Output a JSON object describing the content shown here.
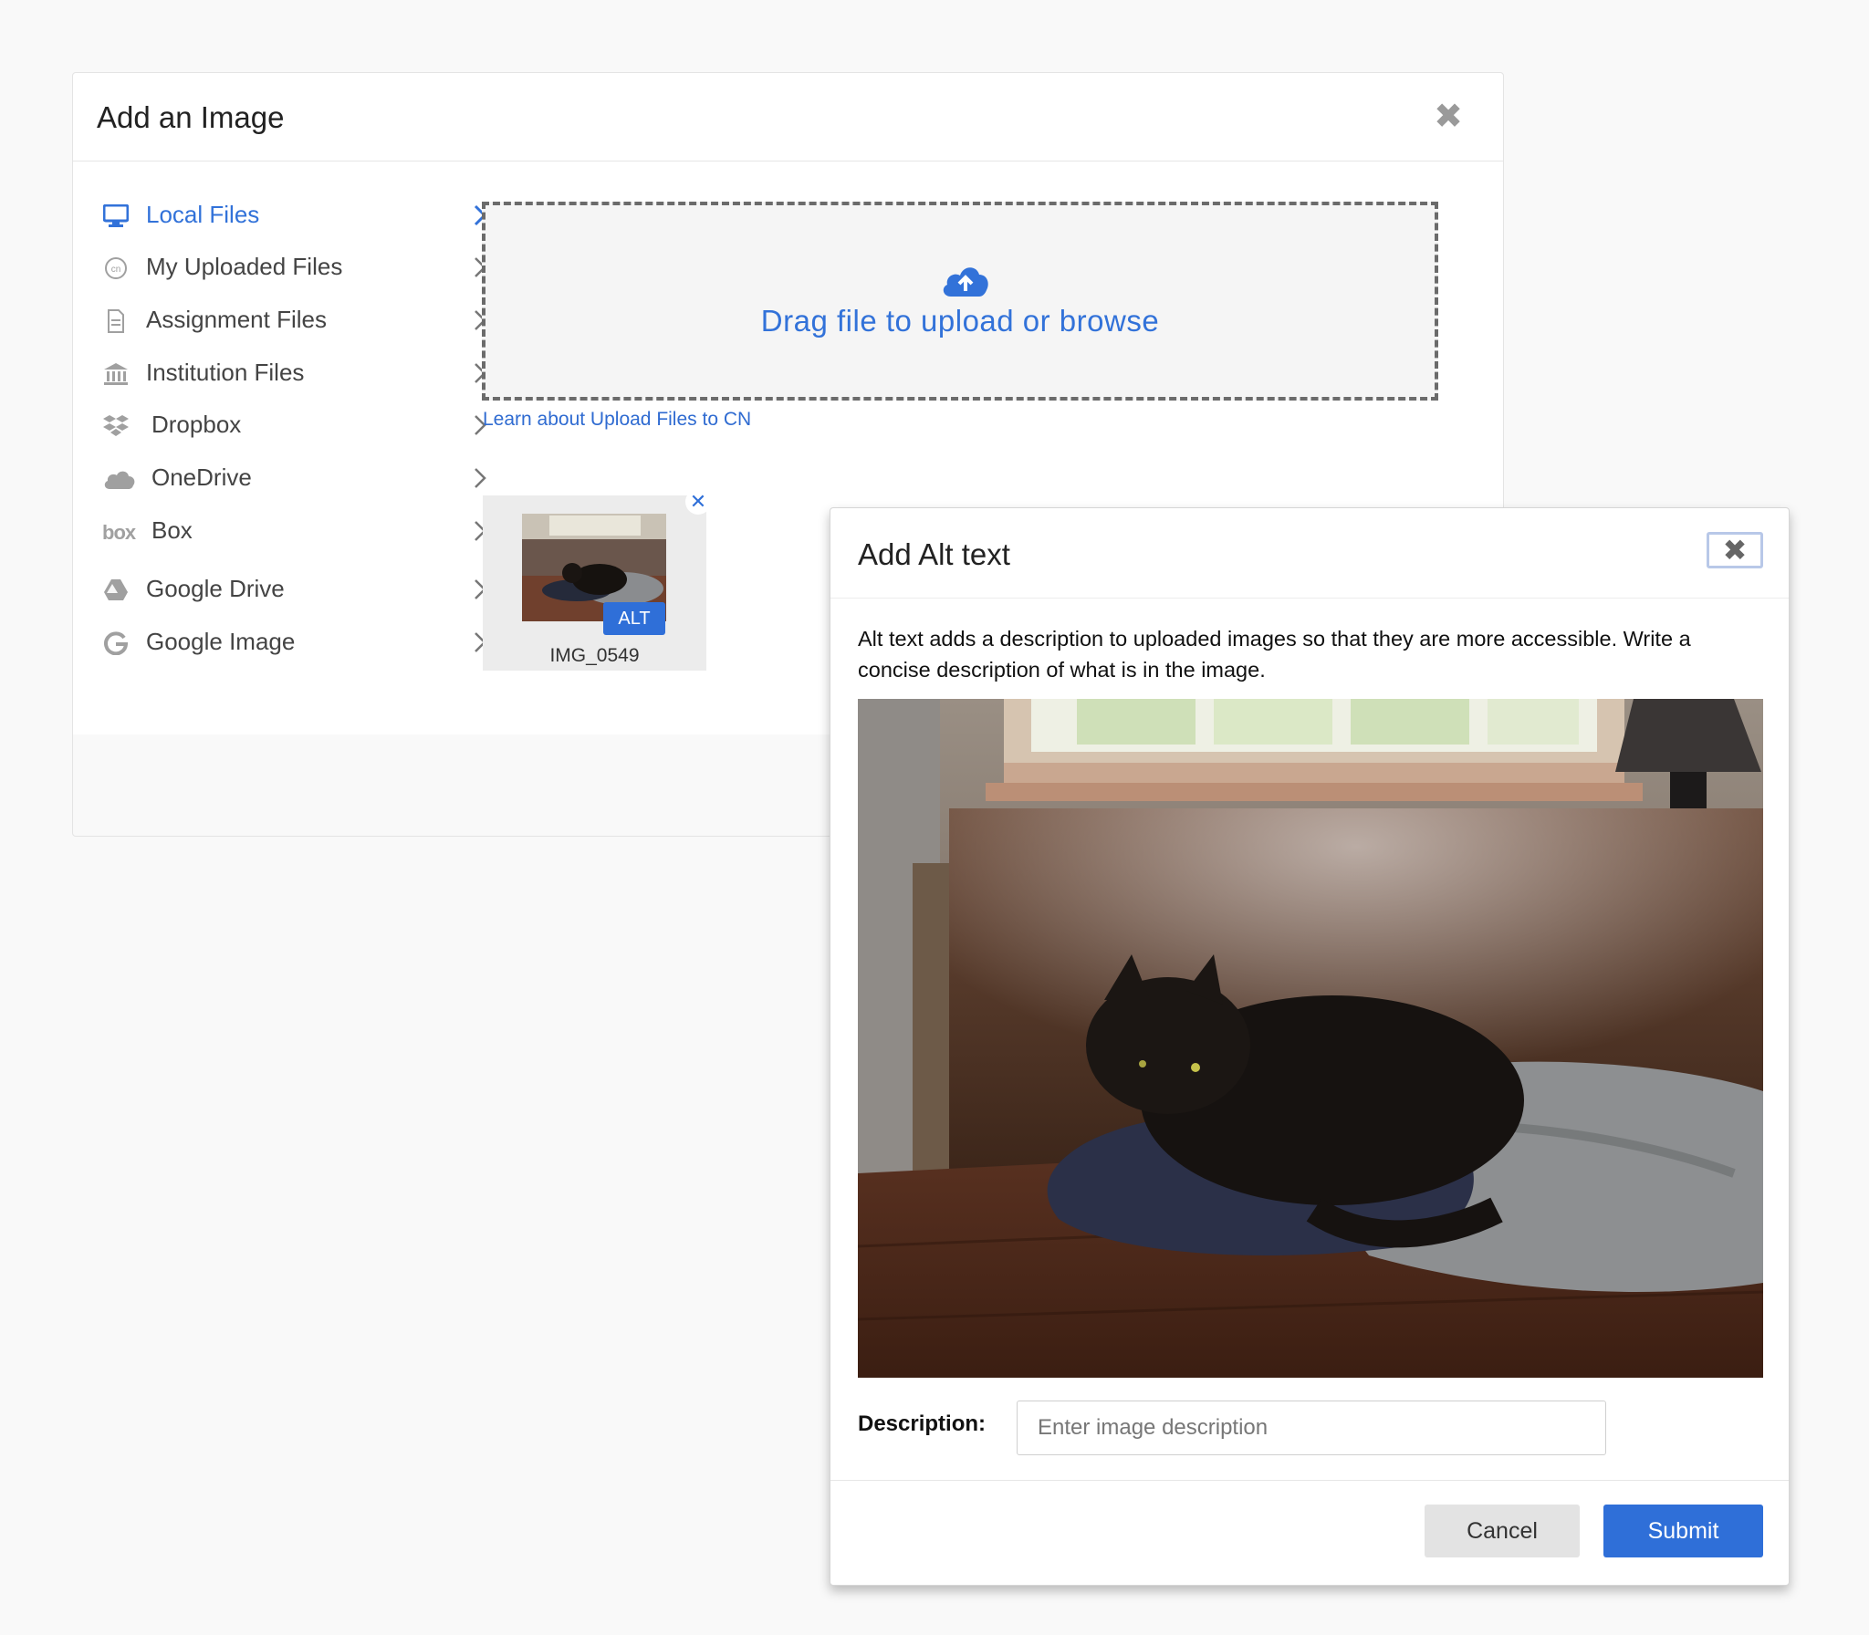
{
  "main_dialog": {
    "title": "Add an Image",
    "close_glyph": "✖",
    "sidebar": {
      "items": [
        {
          "label": "Local Files",
          "icon": "monitor-icon",
          "active": true
        },
        {
          "label": "My Uploaded Files",
          "icon": "cn-icon"
        },
        {
          "label": "Assignment Files",
          "icon": "document-icon"
        },
        {
          "label": "Institution Files",
          "icon": "institution-icon"
        },
        {
          "label": "Dropbox",
          "icon": "dropbox-icon"
        },
        {
          "label": "OneDrive",
          "icon": "cloud-icon"
        },
        {
          "label": "Box",
          "icon": "box-icon"
        },
        {
          "label": "Google Drive",
          "icon": "google-drive-icon"
        },
        {
          "label": "Google Image",
          "icon": "google-icon"
        }
      ]
    },
    "dropzone": {
      "text": "Drag file to upload or browse",
      "icon": "cloud-upload-icon"
    },
    "learn_link": "Learn about Upload Files to CN",
    "thumbnail": {
      "filename": "IMG_0549",
      "badge": "ALT",
      "remove_glyph": "✕"
    }
  },
  "alt_dialog": {
    "title": "Add Alt text",
    "close_glyph": "✖",
    "description": "Alt text adds a description to uploaded images so that they are more accessible. Write a concise description of what is in the image.",
    "field_label": "Description:",
    "field_placeholder": "Enter image description",
    "field_value": "",
    "cancel_label": "Cancel",
    "submit_label": "Submit"
  },
  "colors": {
    "accent": "#3272d9",
    "button_primary": "#2f6fd8",
    "button_secondary": "#e3e3e3"
  }
}
